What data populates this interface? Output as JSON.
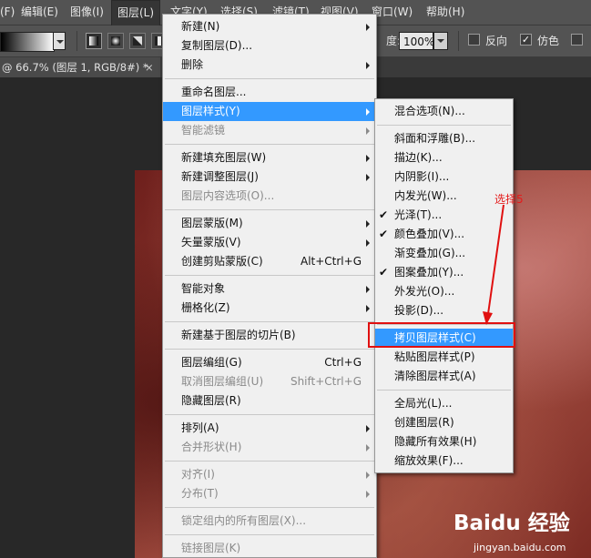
{
  "menubar": {
    "items": [
      {
        "label": "文件(F)"
      },
      {
        "label": "编辑(E)"
      },
      {
        "label": "图像(I)"
      },
      {
        "label": "图层(L)"
      },
      {
        "label": "文字(Y)"
      },
      {
        "label": "选择(S)"
      },
      {
        "label": "滤镜(T)"
      },
      {
        "label": "视图(V)"
      },
      {
        "label": "窗口(W)"
      },
      {
        "label": "帮助(H)"
      }
    ]
  },
  "options_bar": {
    "opacity_label": "度:",
    "opacity_value": "100%",
    "reverse_label": "反向",
    "dither_label": "仿色",
    "dither_checked": true,
    "checkmark": "✓"
  },
  "document_tab": {
    "title": "@ 66.7% (图层 1, RGB/8#) *",
    "close": "×"
  },
  "layer_menu": {
    "items": [
      {
        "label": "新建(N)",
        "arrow": true
      },
      {
        "label": "复制图层(D)..."
      },
      {
        "label": "删除",
        "arrow": true
      },
      {
        "sep": true
      },
      {
        "label": "重命名图层..."
      },
      {
        "label": "图层样式(Y)",
        "arrow": true,
        "highlighted": true
      },
      {
        "label": "智能滤镜",
        "arrow": true,
        "disabled": true
      },
      {
        "sep": true
      },
      {
        "label": "新建填充图层(W)",
        "arrow": true
      },
      {
        "label": "新建调整图层(J)",
        "arrow": true
      },
      {
        "label": "图层内容选项(O)...",
        "disabled": true
      },
      {
        "sep": true
      },
      {
        "label": "图层蒙版(M)",
        "arrow": true
      },
      {
        "label": "矢量蒙版(V)",
        "arrow": true
      },
      {
        "label": "创建剪贴蒙版(C)",
        "shortcut": "Alt+Ctrl+G"
      },
      {
        "sep": true
      },
      {
        "label": "智能对象",
        "arrow": true
      },
      {
        "label": "栅格化(Z)",
        "arrow": true
      },
      {
        "sep": true
      },
      {
        "label": "新建基于图层的切片(B)"
      },
      {
        "sep": true
      },
      {
        "label": "图层编组(G)",
        "shortcut": "Ctrl+G"
      },
      {
        "label": "取消图层编组(U)",
        "shortcut": "Shift+Ctrl+G",
        "disabled": true
      },
      {
        "label": "隐藏图层(R)"
      },
      {
        "sep": true
      },
      {
        "label": "排列(A)",
        "arrow": true
      },
      {
        "label": "合并形状(H)",
        "arrow": true,
        "disabled": true
      },
      {
        "sep": true
      },
      {
        "label": "对齐(I)",
        "arrow": true,
        "disabled": true
      },
      {
        "label": "分布(T)",
        "arrow": true,
        "disabled": true
      },
      {
        "sep": true
      },
      {
        "label": "锁定组内的所有图层(X)...",
        "disabled": true
      },
      {
        "sep": true
      },
      {
        "label": "链接图层(K)",
        "disabled": true
      }
    ]
  },
  "layer_style_submenu": {
    "items": [
      {
        "label": "混合选项(N)..."
      },
      {
        "sep": true
      },
      {
        "label": "斜面和浮雕(B)..."
      },
      {
        "label": "描边(K)..."
      },
      {
        "label": "内阴影(I)..."
      },
      {
        "label": "内发光(W)..."
      },
      {
        "label": "光泽(T)...",
        "checked": true
      },
      {
        "label": "颜色叠加(V)...",
        "checked": true
      },
      {
        "label": "渐变叠加(G)..."
      },
      {
        "label": "图案叠加(Y)...",
        "checked": true
      },
      {
        "label": "外发光(O)..."
      },
      {
        "label": "投影(D)..."
      },
      {
        "sep": true
      },
      {
        "label": "拷贝图层样式(C)",
        "highlighted": true
      },
      {
        "label": "粘贴图层样式(P)"
      },
      {
        "label": "清除图层样式(A)"
      },
      {
        "sep": true
      },
      {
        "label": "全局光(L)..."
      },
      {
        "label": "创建图层(R)"
      },
      {
        "label": "隐藏所有效果(H)"
      },
      {
        "label": "缩放效果(F)..."
      }
    ]
  },
  "annotation": {
    "text": "选择5",
    "color": "#e41b1b"
  },
  "watermark": {
    "logo": "Baidu 经验",
    "url": "jingyan.baidu.com"
  },
  "colors": {
    "menu_highlight": "#3399ff",
    "annotation_red": "#e01010"
  }
}
